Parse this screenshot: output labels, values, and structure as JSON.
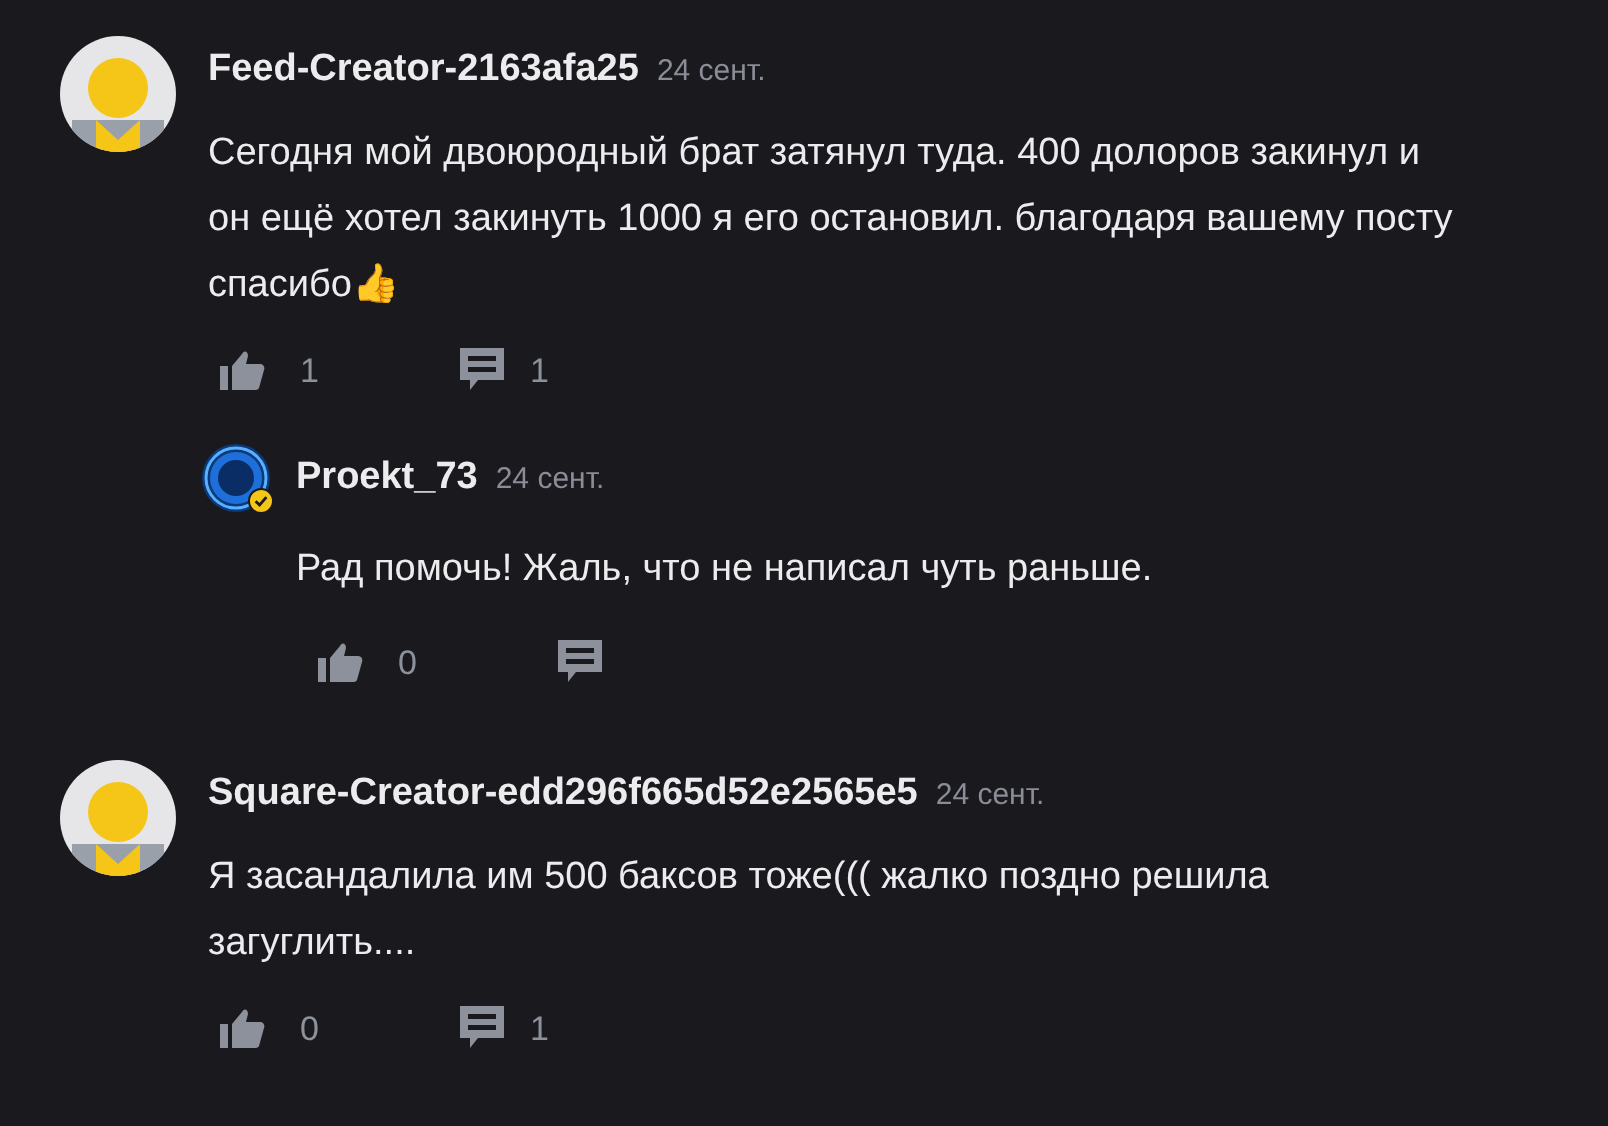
{
  "comments": [
    {
      "kind": "comment",
      "author": "Feed-Creator-2163afa25",
      "verified": false,
      "date": "24 сент.",
      "text": "Сегодня мой двоюродный брат затянул туда. 400 долоров закинул и он ещё хотел закинуть 1000 я его остановил. благодаря вашему посту спасибо👍",
      "likes": "1",
      "replies": "1"
    },
    {
      "kind": "reply",
      "author": "Proekt_73",
      "verified": true,
      "date": "24 сент.",
      "text": "Рад помочь! Жаль, что не написал чуть раньше.",
      "likes": "0"
    },
    {
      "kind": "comment",
      "author": "Square-Creator-edd296f665d52e2565e5",
      "verified": false,
      "date": "24 сент.",
      "text": "Я засандалила им 500 баксов тоже((( жалко поздно решила загуглить....",
      "likes": "0",
      "replies": "1"
    }
  ]
}
